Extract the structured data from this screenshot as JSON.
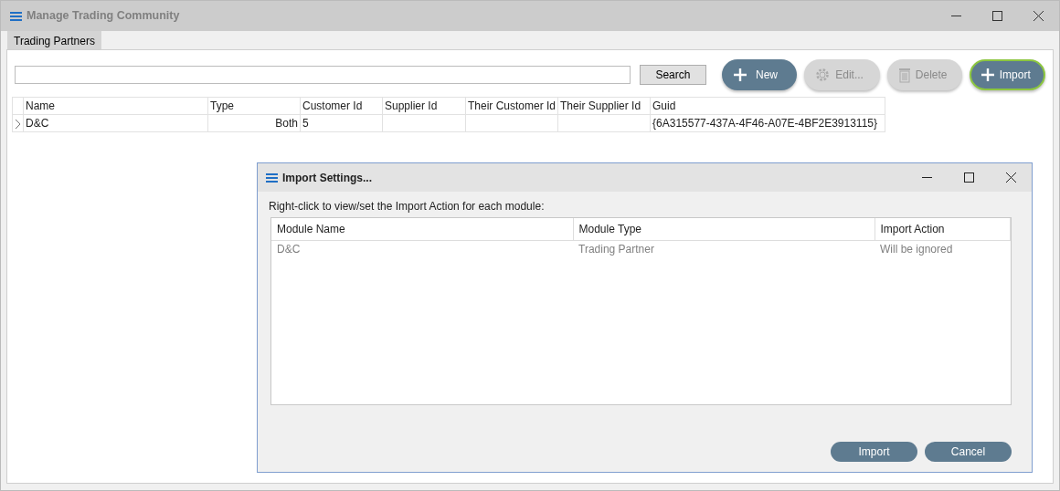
{
  "window": {
    "title": "Manage Trading Community"
  },
  "tabs": [
    {
      "label": "Trading Partners",
      "selected": true
    }
  ],
  "search": {
    "button": "Search"
  },
  "actions": [
    {
      "kind": "plus",
      "label": "New",
      "disabled": false,
      "focused": false
    },
    {
      "kind": "gear",
      "label": "Edit...",
      "disabled": true,
      "focused": false
    },
    {
      "kind": "trash",
      "label": "Delete",
      "disabled": true,
      "focused": false
    },
    {
      "kind": "plus",
      "label": "Import",
      "disabled": false,
      "focused": true
    }
  ],
  "table": {
    "columns": [
      "Name",
      "Type",
      "Customer Id",
      "Supplier Id",
      "Their Customer Id",
      "Their Supplier Id",
      "Guid"
    ],
    "rows": [
      {
        "current": true,
        "cells": [
          "D&C",
          "Both",
          "5",
          "",
          "",
          "",
          "{6A315577-437A-4F46-A07E-4BF2E3913115}"
        ]
      }
    ]
  },
  "dialog": {
    "title": "Import Settings...",
    "instruction": "Right-click to view/set the Import Action for each module:",
    "columns": [
      "Module Name",
      "Module Type",
      "Import Action"
    ],
    "rows": [
      {
        "cells": [
          "D&C",
          "Trading Partner",
          "Will be ignored"
        ]
      }
    ],
    "buttons": [
      "Import",
      "Cancel"
    ]
  }
}
